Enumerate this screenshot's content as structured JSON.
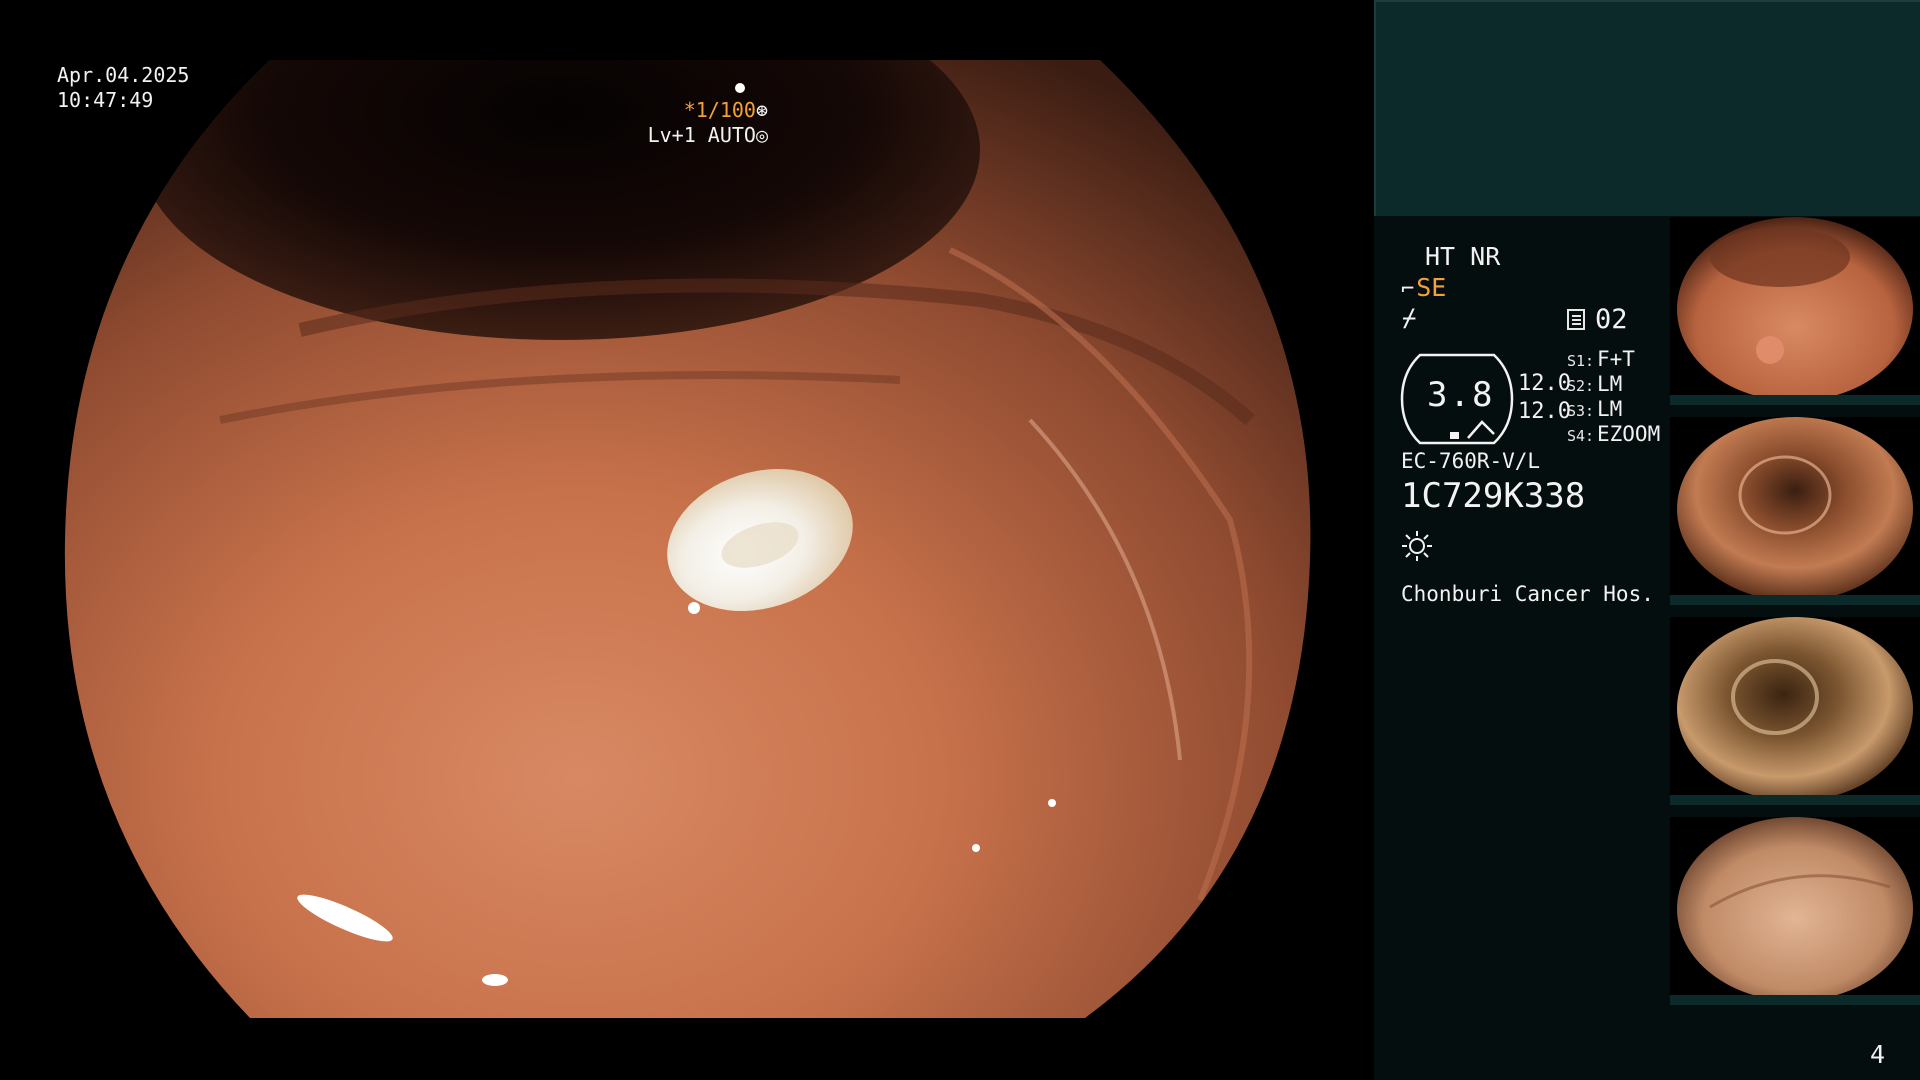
{
  "overlay": {
    "date": "Apr.04.2025",
    "time": "10:47:49",
    "shutter_speed": "*1/100",
    "shutter_icon": "aperture-icon",
    "exposure_mode": "Lv+1 AUTO",
    "exposure_icon": "iris-icon"
  },
  "panel": {
    "ht_nr": "HT NR",
    "structure_enhance": "SE",
    "structure_icon": "scope-tip-icon",
    "sharpness_icon": "slash-icon",
    "mode_icon": "memory-icon",
    "mode_number": "02",
    "zoom_value": "3.8",
    "value_upper": "12.0",
    "value_lower": "12.0",
    "switches": [
      {
        "label": "S1:",
        "value": "F+T"
      },
      {
        "label": "S2:",
        "value": "LM"
      },
      {
        "label": "S3:",
        "value": "LM"
      },
      {
        "label": "S4:",
        "value": "EZOOM"
      }
    ],
    "scope_model": "EC-760R-V/L",
    "scope_serial": "1C729K338",
    "light_icon": "light-source-icon",
    "hospital": "Chonburi Cancer Hos."
  },
  "thumbnails": [
    {
      "name": "captured-image-1"
    },
    {
      "name": "captured-image-2"
    },
    {
      "name": "captured-image-3"
    },
    {
      "name": "captured-image-4"
    }
  ],
  "page_number": "4",
  "colors": {
    "accent_orange": "#f2a238",
    "panel_top": "#0d2a2a",
    "panel_body": "#050e0e",
    "mucosa": "#c8764f"
  }
}
